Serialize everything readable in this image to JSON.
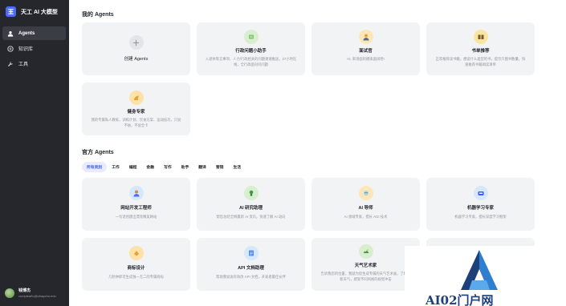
{
  "app": {
    "title": "天工 AI 大模型"
  },
  "sidebar": {
    "items": [
      {
        "label": "Agents",
        "icon": "agents-icon",
        "active": true
      },
      {
        "label": "知识库",
        "icon": "knowledge-base-icon",
        "active": false
      },
      {
        "label": "工具",
        "icon": "tools-icon",
        "active": false
      }
    ],
    "user": {
      "name": "钱博杰",
      "email": "cumpleaño@ohayoho.edu"
    }
  },
  "my_agents": {
    "title": "我的 Agents",
    "cards": [
      {
        "name": "创建 Agents",
        "desc": "",
        "icon": "plus-icon",
        "color": "#e3e5e9"
      },
      {
        "name": "行政问题小助手",
        "desc": "入退休等言事项、人力/行政相关的问题请速推送，27小时在线，全行政面对问问题",
        "icon": "assistant-icon",
        "color": "#d8efcf"
      },
      {
        "name": "面试官",
        "desc": "Hi, 来场面的模拟面试吧!",
        "icon": "interviewer-icon",
        "color": "#fde7b8"
      },
      {
        "name": "书单推荐",
        "desc": "正常推荐读书籍，想读什么类型的书，提示只图书数量，快速推荐书籍阅读清单",
        "icon": "book-icon",
        "color": "#f8e6a0"
      },
      {
        "name": "健身专家",
        "desc": "我的专属私人教练，训练计划、饮食方案、运动技巧，只说不妨，不说全卡",
        "icon": "fitness-icon",
        "color": "#fde2a8"
      }
    ]
  },
  "official_agents": {
    "title": "官方 Agents",
    "tabs": [
      "所有类别",
      "工作",
      "编程",
      "金融",
      "写作",
      "助手",
      "翻译",
      "营销",
      "生活"
    ],
    "active_tab": 0,
    "cards": [
      {
        "name": "网站开发工程师",
        "desc": "一句话创建出漂亮精美网站",
        "icon": "developer-icon",
        "color": "#d6e8fb"
      },
      {
        "name": "AI 研究助理",
        "desc": "帮您总结全网最新 AI 资讯，快速了解 AI 动向",
        "icon": "research-icon",
        "color": "#d8efcf"
      },
      {
        "name": "AI 导师",
        "desc": "AI 领域专家，擅长 AGI 技术",
        "icon": "mentor-icon",
        "color": "#fde7b8"
      },
      {
        "name": "机器学习专家",
        "desc": "机器学习专家，擅长深度学习框架",
        "icon": "ml-icon",
        "color": "#d6e8fb"
      },
      {
        "name": "商标设计",
        "desc": "几秒钟即可生成独一无二的专属商标",
        "icon": "trademark-icon",
        "color": "#fde2a8"
      },
      {
        "name": "API 文档助理",
        "desc": "帮助我说说有效改 API 文档，开发者最佳伙伴",
        "icon": "api-doc-icon",
        "color": "#d6e8fb"
      },
      {
        "name": "天气艺术家",
        "desc": "告诉我您的位置，我就为您生成专属的天气艺术画，了解最新天气，感受不同风格的视觉冲击",
        "icon": "weather-art-icon",
        "color": "#d8efcf"
      }
    ]
  },
  "watermark": {
    "text": "AI02门户网"
  },
  "colors": {
    "sidebar_bg": "#26272c",
    "accent": "#3b5cf0",
    "card_bg": "#f2f3f5"
  }
}
